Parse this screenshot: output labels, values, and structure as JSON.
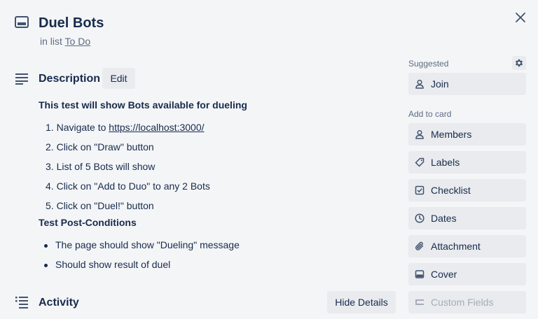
{
  "card": {
    "title": "Duel Bots",
    "in_list_prefix": "in list",
    "list_name": "To Do"
  },
  "description": {
    "title": "Description",
    "edit_label": "Edit",
    "heading": "This test will show Bots available for dueling",
    "steps": [
      {
        "num": "1.",
        "text": "Navigate to ",
        "link": "https://localhost:3000/"
      },
      {
        "num": "2.",
        "text": "Click on \"Draw\" button"
      },
      {
        "num": "3.",
        "text": "List of 5 Bots will show"
      },
      {
        "num": "4.",
        "text": "Click on \"Add to Duo\" to any 2 Bots"
      },
      {
        "num": "5.",
        "text": "Click on \"Duel!\" button"
      }
    ],
    "post_heading": "Test Post-Conditions",
    "post_items": [
      "The page should show \"Dueling\" message",
      "Should show result of duel"
    ]
  },
  "activity": {
    "title": "Activity",
    "hide_details_label": "Hide Details"
  },
  "sidebar": {
    "suggested_label": "Suggested",
    "join_label": "Join",
    "add_to_card_label": "Add to card",
    "buttons": [
      {
        "label": "Members",
        "icon": "person-icon"
      },
      {
        "label": "Labels",
        "icon": "tag-icon"
      },
      {
        "label": "Checklist",
        "icon": "checklist-icon"
      },
      {
        "label": "Dates",
        "icon": "clock-icon"
      },
      {
        "label": "Attachment",
        "icon": "paperclip-icon"
      },
      {
        "label": "Cover",
        "icon": "cover-icon"
      },
      {
        "label": "Custom Fields",
        "icon": "custom-fields-icon",
        "disabled": true
      }
    ]
  },
  "colors": {
    "background": "#f4f5f7",
    "button_bg": "#e9ebee",
    "text": "#172b4d",
    "muted": "#5e6c84",
    "disabled": "#a5adba"
  }
}
